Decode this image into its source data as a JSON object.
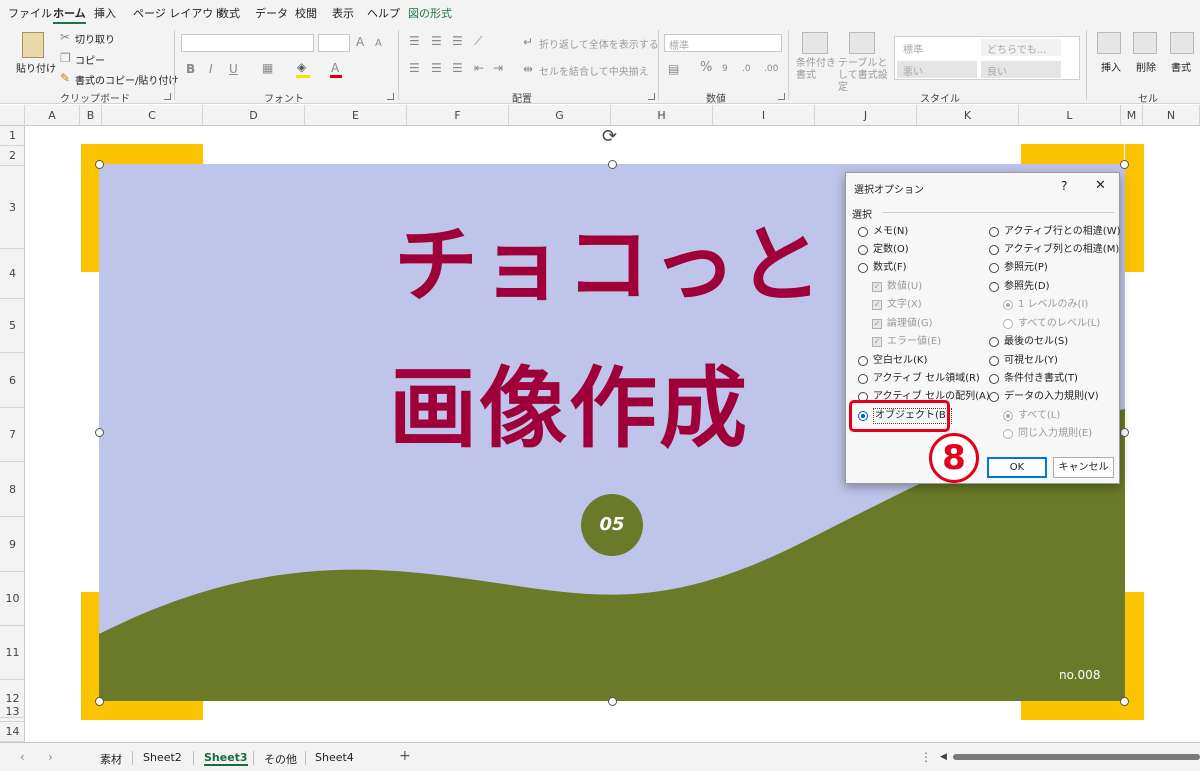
{
  "menubar": {
    "items": [
      "ファイル",
      "ホーム",
      "挿入",
      "ページ レイアウト",
      "数式",
      "データ",
      "校閲",
      "表示",
      "ヘルプ",
      "図の形式"
    ]
  },
  "ribbon": {
    "clipboard": {
      "paste": "貼り付け",
      "cut": "切り取り",
      "copy": "コピー",
      "format_painter": "書式のコピー/貼り付け",
      "group": "クリップボード"
    },
    "font": {
      "bold": "B",
      "italic": "I",
      "underline": "U",
      "font_color": "A",
      "grow": "A",
      "shrink": "A",
      "group": "フォント"
    },
    "alignment": {
      "wrap": "折り返して全体を表示する",
      "merge": "セルを結合して中央揃え",
      "group": "配置"
    },
    "number": {
      "format": "標準",
      "percent": "%",
      "group": "数値"
    },
    "styles": {
      "conditional": "条件付き書式",
      "table": "テーブルとして書式設定",
      "normal": "標準",
      "neutral": "どちらでも...",
      "bad": "悪い",
      "good": "良い",
      "group": "スタイル"
    },
    "cells": {
      "insert": "挿入",
      "delete": "削除",
      "format": "書式",
      "group": "セル"
    }
  },
  "columns": [
    "A",
    "B",
    "C",
    "D",
    "E",
    "F",
    "G",
    "H",
    "I",
    "J",
    "K",
    "L",
    "M",
    "N"
  ],
  "rows": [
    "1",
    "2",
    "3",
    "4",
    "5",
    "6",
    "7",
    "8",
    "9",
    "10",
    "11",
    "12",
    "13",
    "14"
  ],
  "picture": {
    "title_line1": "チョコっと",
    "title_line2": "画像作成",
    "badge": "05",
    "page_number": "no.008",
    "colors": {
      "sky": "#bfc5ea",
      "hill": "#6a7a28",
      "title": "#a0003a",
      "frame": "#fbc300"
    }
  },
  "dialog": {
    "title": "選択オプション",
    "help": "?",
    "close": "✕",
    "group_label": "選択",
    "left_options": [
      {
        "label": "メモ(N)",
        "kind": "radio",
        "state": "off"
      },
      {
        "label": "定数(O)",
        "kind": "radio",
        "state": "off"
      },
      {
        "label": "数式(F)",
        "kind": "radio",
        "state": "off"
      },
      {
        "label": "数値(U)",
        "kind": "check",
        "state": "disabled"
      },
      {
        "label": "文字(X)",
        "kind": "check",
        "state": "disabled"
      },
      {
        "label": "論理値(G)",
        "kind": "check",
        "state": "disabled"
      },
      {
        "label": "エラー値(E)",
        "kind": "check",
        "state": "disabled"
      },
      {
        "label": "空白セル(K)",
        "kind": "radio",
        "state": "off"
      },
      {
        "label": "アクティブ セル領域(R)",
        "kind": "radio",
        "state": "off"
      },
      {
        "label": "アクティブ セルの配列(A)",
        "kind": "radio",
        "state": "off"
      },
      {
        "label": "オブジェクト(B)",
        "kind": "radio",
        "state": "on"
      }
    ],
    "right_options": [
      {
        "label": "アクティブ行との相違(W)",
        "kind": "radio",
        "state": "off"
      },
      {
        "label": "アクティブ列との相違(M)",
        "kind": "radio",
        "state": "off"
      },
      {
        "label": "参照元(P)",
        "kind": "radio",
        "state": "off"
      },
      {
        "label": "参照先(D)",
        "kind": "radio",
        "state": "off"
      },
      {
        "label": "1 レベルのみ(I)",
        "kind": "radio",
        "state": "disabled-on"
      },
      {
        "label": "すべてのレベル(L)",
        "kind": "radio",
        "state": "disabled"
      },
      {
        "label": "最後のセル(S)",
        "kind": "radio",
        "state": "off"
      },
      {
        "label": "可視セル(Y)",
        "kind": "radio",
        "state": "off"
      },
      {
        "label": "条件付き書式(T)",
        "kind": "radio",
        "state": "off"
      },
      {
        "label": "データの入力規則(V)",
        "kind": "radio",
        "state": "off"
      },
      {
        "label": "すべて(L)",
        "kind": "radio",
        "state": "disabled-on"
      },
      {
        "label": "同じ入力規則(E)",
        "kind": "radio",
        "state": "disabled"
      }
    ],
    "ok": "OK",
    "cancel": "キャンセル"
  },
  "annotation": {
    "step": "8",
    "color": "#e3001b"
  },
  "sheet_tabs": [
    "素材",
    "Sheet2",
    "Sheet3",
    "その他",
    "Sheet4"
  ],
  "active_tab": "Sheet3",
  "add_sheet": "+"
}
